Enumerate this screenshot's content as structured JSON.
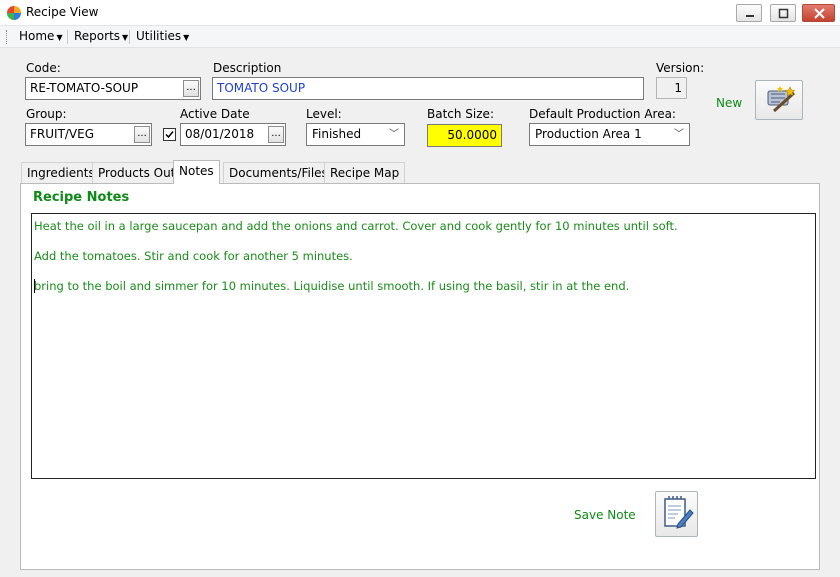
{
  "window": {
    "title": "Recipe View",
    "icon": "app-color-wheel-icon"
  },
  "menu": [
    {
      "label": "Home"
    },
    {
      "label": "Reports"
    },
    {
      "label": "Utilities"
    }
  ],
  "form": {
    "code_label": "Code:",
    "code_value": "RE-TOMATO-SOUP",
    "description_label": "Description",
    "description_value": "TOMATO SOUP",
    "version_label": "Version:",
    "version_value": "1",
    "new_label": "New",
    "group_label": "Group:",
    "group_value": "FRUIT/VEG",
    "active_date_label": "Active Date",
    "active_date_value": "08/01/2018",
    "active_checked": true,
    "level_label": "Level:",
    "level_value": "Finished",
    "batch_label": "Batch Size:",
    "batch_value": "50.0000",
    "area_label": "Default Production Area:",
    "area_value": "Production Area 1",
    "browse_label": "..."
  },
  "tabs": [
    {
      "label": "Ingredients"
    },
    {
      "label": "Products Out"
    },
    {
      "label": "Notes",
      "active": true
    },
    {
      "label": "Documents/Files"
    },
    {
      "label": "Recipe Map"
    }
  ],
  "notes": {
    "title": "Recipe Notes",
    "lines": [
      "Heat the oil in a large saucepan and add the onions and carrot. Cover and cook gently for 10 minutes until soft.",
      "Add the tomatoes. Stir and cook for another 5 minutes.",
      "bring to the boil and simmer for 10 minutes. Liquidise until smooth. If using the basil, stir in at the end."
    ],
    "save_label": "Save Note"
  },
  "colors": {
    "accent_green": "#0e8a16",
    "batch_highlight": "#ffff00",
    "description_text": "#1f3fcf"
  }
}
